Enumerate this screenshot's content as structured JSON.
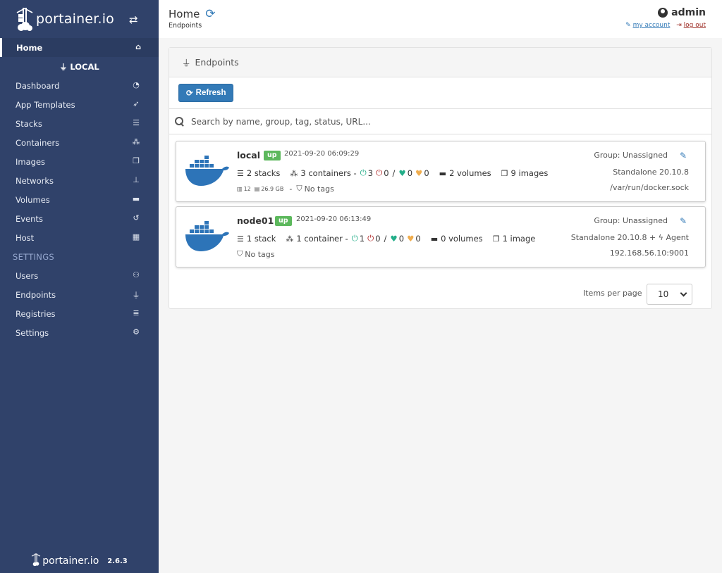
{
  "sidebar": {
    "brand": "portainer.io",
    "home": "Home",
    "endpoint_name": "LOCAL",
    "endpoint_items": [
      "Dashboard",
      "App Templates",
      "Stacks",
      "Containers",
      "Images",
      "Networks",
      "Volumes",
      "Events",
      "Host"
    ],
    "settings_title": "SETTINGS",
    "settings_items": [
      "Users",
      "Endpoints",
      "Registries",
      "Settings"
    ],
    "footer_brand": "portainer.io",
    "version": "2.6.3"
  },
  "header": {
    "title": "Home",
    "breadcrumb": "Endpoints",
    "username": "admin",
    "my_account": "my account",
    "log_out": "log out"
  },
  "widget": {
    "title": "Endpoints",
    "refresh_button": "Refresh",
    "search_placeholder": "Search by name, group, tag, status, URL..."
  },
  "endpoints": [
    {
      "name": "local",
      "status": "up",
      "timestamp": "2021-09-20 06:09:29",
      "stacks": "2 stacks",
      "containers": "3 containers -",
      "running": "3",
      "stopped": "0",
      "healthy": "0",
      "unhealthy": "0",
      "volumes": "2 volumes",
      "images": "9 images",
      "cpu": "12",
      "memory": "26.9 GB",
      "tags": "No tags",
      "group": "Group: Unassigned",
      "type": "Standalone 20.10.8",
      "url": "/var/run/docker.sock"
    },
    {
      "name": "node01",
      "status": "up",
      "timestamp": "2021-09-20 06:13:49",
      "stacks": "1 stack",
      "containers": "1 container -",
      "running": "1",
      "stopped": "0",
      "healthy": "0",
      "unhealthy": "0",
      "volumes": "0 volumes",
      "images": "1 image",
      "tags": "No tags",
      "group": "Group: Unassigned",
      "type": "Standalone 20.10.8 + ",
      "agent": "Agent",
      "url": "192.168.56.10:9001"
    }
  ],
  "pagination": {
    "items_per_page_label": "Items per page",
    "items_per_page": "10"
  },
  "colors": {
    "sidebar": "#30426a",
    "primary": "#337ab7",
    "success": "#5cb85c"
  }
}
